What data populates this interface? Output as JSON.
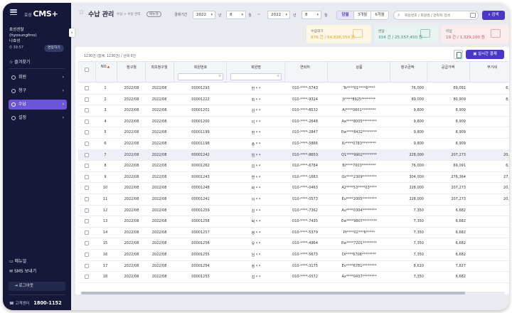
{
  "sidebar": {
    "logo_small": "효성",
    "logo": "CMS+",
    "org_name": "효성센탈",
    "org_id": "(hyosungfms)",
    "user": "나효성",
    "timer": "39:57",
    "extend_label": "연장하기",
    "favorites_label": "즐겨찾기",
    "menu": [
      {
        "label": "회원",
        "active": false
      },
      {
        "label": "청구",
        "active": false
      },
      {
        "label": "수납",
        "active": true
      },
      {
        "label": "설정",
        "active": false
      }
    ],
    "manual_label": "매뉴얼",
    "sms_label": "SMS 보내기",
    "logout_label": "로그아웃",
    "cs_label": "고객센터",
    "cs_phone": "1800-1152"
  },
  "header": {
    "title": "수납 관리",
    "breadcrumb": "수납 > 수납 관리",
    "manual_badge": "매뉴얼",
    "period_label": "결제기간",
    "from_year": "2022",
    "from_month": "8",
    "to_year": "2022",
    "to_month": "8",
    "year_unit": "년",
    "month_unit": "월",
    "range_separator": "~",
    "range_tabs": [
      "당월",
      "3개월",
      "6개월"
    ],
    "active_range": "당월",
    "search_placeholder": "회원번호 / 회원명 / 연락처 검색",
    "search_button": "검색"
  },
  "summary_cards": [
    {
      "title": "수납대기",
      "value": "876 건 / 64,828,350 원",
      "color": "#e0a020",
      "bg": "#fdf6e4"
    },
    {
      "title": "완납",
      "value": "334 건 / 25,557,450 원",
      "color": "#3a8f7e",
      "bg": "#e7f3f0"
    },
    {
      "title": "미납",
      "value": "19 건 / 1,329,200 원",
      "color": "#d0505c",
      "bg": "#fbecee"
    }
  ],
  "table": {
    "count_text": "1230건 (합계: 1230건) / 선택 0건",
    "live_payment_button": "실시간 결제",
    "columns": [
      "NO.",
      "청구월",
      "최초청구월",
      "회원번호",
      "회원명",
      "연락처",
      "상품",
      "청구금액",
      "공급가액",
      "부가세"
    ],
    "rows": [
      [
        "1",
        "2022/08",
        "2022/08",
        "00001293",
        "한 * *",
        "010-****-5743",
        "To****01****6****",
        "76,000",
        "69,091",
        "6,"
      ],
      [
        "2",
        "2022/08",
        "2022/08",
        "00001222",
        "최 * *",
        "010-****-9324",
        "Jt****8925********",
        "89,000",
        "80,909",
        "8,"
      ],
      [
        "3",
        "2022/08",
        "2022/08",
        "00001201",
        "김 * *",
        "010-****-8532",
        "Ai****0601********",
        "9,800",
        "8,909",
        ""
      ],
      [
        "4",
        "2022/08",
        "2022/08",
        "00001200",
        "이 * *",
        "010-****-2648",
        "Aa****8005********",
        "9,800",
        "8,909",
        ""
      ],
      [
        "5",
        "2022/08",
        "2022/08",
        "00001199",
        "현 * *",
        "010-****-2847",
        "Ew****8432********",
        "9,800",
        "8,909",
        ""
      ],
      [
        "6",
        "2022/08",
        "2022/08",
        "00001198",
        "송 * *",
        "010-****-5866",
        "Kr****0783********",
        "9,800",
        "8,909",
        ""
      ],
      [
        "7",
        "2022/08",
        "2022/08",
        "00001242",
        "임 * *",
        "010-****-8653",
        "Q1****9902********",
        "228,000",
        "207,273",
        "20,"
      ],
      [
        "8",
        "2022/08",
        "2022/08",
        "00001262",
        "김 * *",
        "010-****-6784",
        "Bi****7003********",
        "76,000",
        "69,091",
        "6,"
      ],
      [
        "9",
        "2022/08",
        "2022/08",
        "00001243",
        "연 * *",
        "010-****-1683",
        "Oz****2309********",
        "304,000",
        "276,364",
        "27,"
      ],
      [
        "10",
        "2022/08",
        "2022/08",
        "00001248",
        "박 * *",
        "010-****-0463",
        "A2****53****03****",
        "228,000",
        "207,273",
        "20,"
      ],
      [
        "11",
        "2022/08",
        "2022/08",
        "00001241",
        "이 * *",
        "010-****-0573",
        "Eu****2005********",
        "228,000",
        "207,273",
        "20,"
      ],
      [
        "12",
        "2022/08",
        "2022/08",
        "00001259",
        "김 * *",
        "010-****-7362",
        "Au****0304********",
        "7,350",
        "6,682",
        ""
      ],
      [
        "13",
        "2022/08",
        "2022/08",
        "00001258",
        "박 * *",
        "010-****-7435",
        "Ew****9807********",
        "7,350",
        "6,682",
        ""
      ],
      [
        "14",
        "2022/08",
        "2022/08",
        "00001257",
        "정 * *",
        "010-****-5379",
        "Pt****02***6*****",
        "7,350",
        "6,682",
        ""
      ],
      [
        "15",
        "2022/08",
        "2022/08",
        "00001256",
        "유 * *",
        "010-****-4964",
        "Ew****7201********",
        "7,350",
        "6,682",
        ""
      ],
      [
        "16",
        "2022/08",
        "2022/08",
        "00001255",
        "임 * *",
        "010-****-5673",
        "Dl****6708********",
        "7,350",
        "6,682",
        ""
      ],
      [
        "17",
        "2022/08",
        "2022/08",
        "00001254",
        "정 * *",
        "010-****-3175",
        "Ev****6781********",
        "8,610",
        "7,827",
        ""
      ],
      [
        "18",
        "2022/08",
        "2022/08",
        "00001253",
        "김 * *",
        "010-****-0572",
        "Ax****0437********",
        "7,350",
        "6,682",
        ""
      ]
    ],
    "highlighted_row": 6
  }
}
